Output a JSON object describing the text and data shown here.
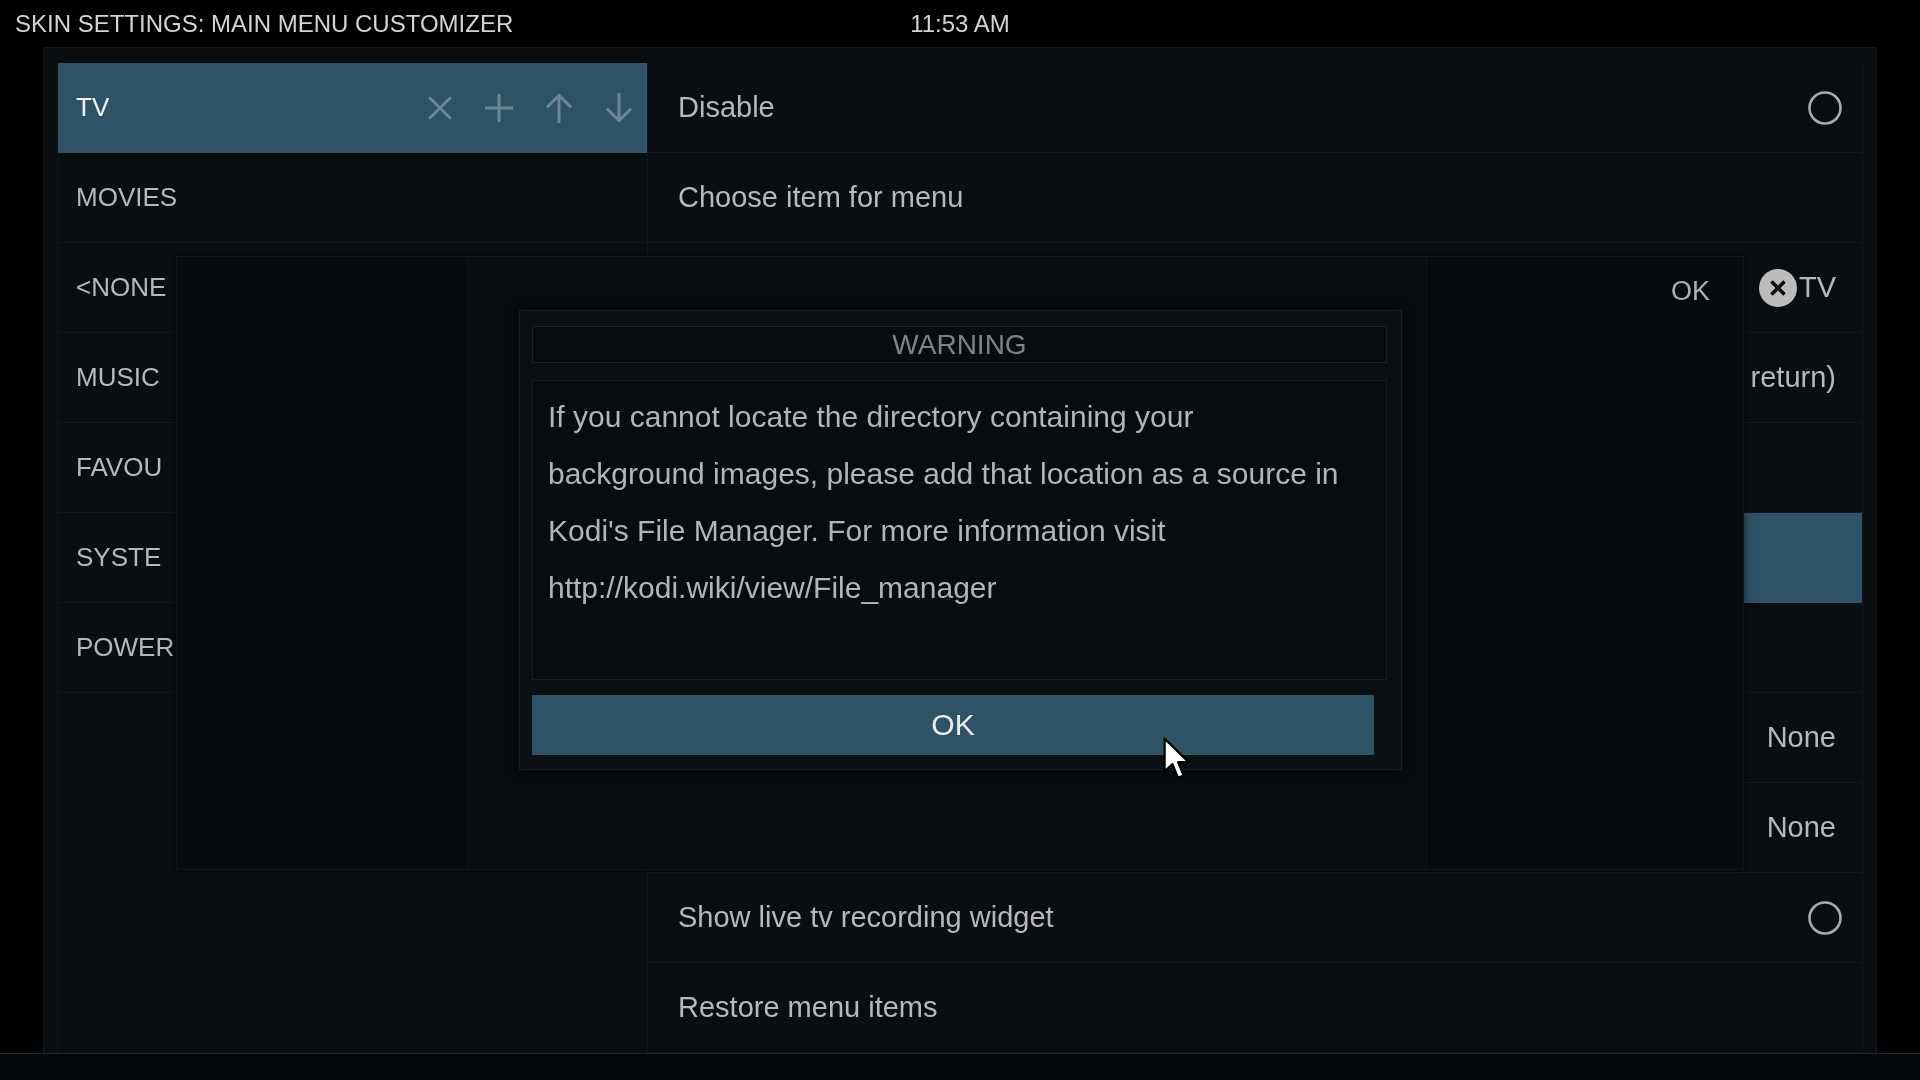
{
  "header": {
    "title": "SKIN SETTINGS: MAIN MENU CUSTOMIZER",
    "clock": "11:53 AM"
  },
  "menu_items": [
    {
      "label": "TV",
      "selected": true
    },
    {
      "label": "MOVIES",
      "selected": false
    },
    {
      "label": "<NONE",
      "selected": false
    },
    {
      "label": "MUSIC",
      "selected": false
    },
    {
      "label": "FAVOU",
      "selected": false
    },
    {
      "label": "SYSTE",
      "selected": false
    },
    {
      "label": "POWER",
      "selected": false
    }
  ],
  "settings": [
    {
      "kind": "radio",
      "label": "Disable",
      "checked": false,
      "selected": false
    },
    {
      "kind": "label",
      "label": "Choose item for menu",
      "selected": false
    },
    {
      "kind": "clearable_value",
      "value": "TV",
      "selected": false
    },
    {
      "kind": "value",
      "value": "return)",
      "selected": false
    },
    {
      "kind": "blank",
      "selected": false
    },
    {
      "kind": "blank",
      "selected": true
    },
    {
      "kind": "blank",
      "selected": false
    },
    {
      "kind": "value",
      "value": "None",
      "selected": false
    },
    {
      "kind": "value",
      "value": "None",
      "selected": false
    },
    {
      "kind": "radio",
      "label": "Show live tv recording widget",
      "checked": false,
      "selected": false
    },
    {
      "kind": "label",
      "label": "Restore menu items",
      "selected": false
    }
  ],
  "select_dialog": {
    "button": "OK"
  },
  "warning_dialog": {
    "title": "WARNING",
    "message": "If you cannot locate the directory containing your\nbackground images, please add that location as a source in\nKodi's File Manager. For more information visit\nhttp://kodi.wiki/view/File_manager",
    "button": "OK"
  }
}
